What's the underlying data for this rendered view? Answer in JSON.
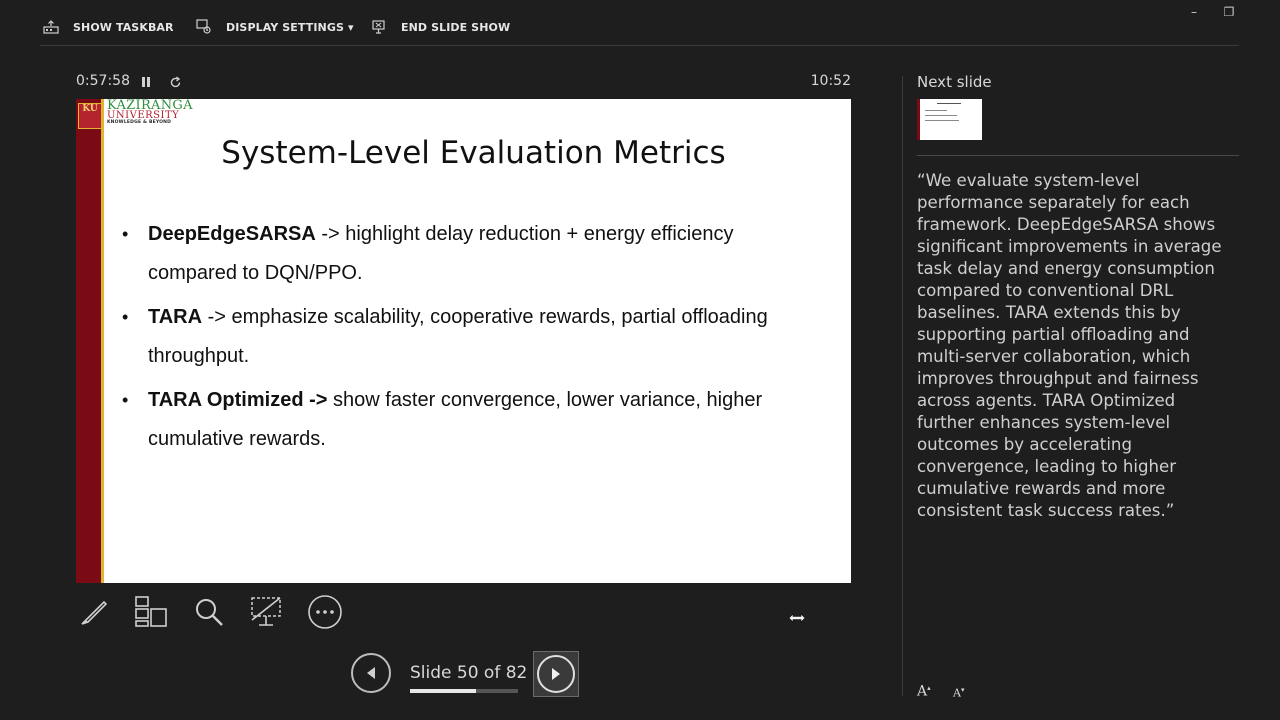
{
  "toolbar": {
    "show_taskbar": "SHOW TASKBAR",
    "display_settings": "DISPLAY SETTINGS ▾",
    "end_slide_show": "END SLIDE SHOW"
  },
  "window_controls": {
    "minimize": "–",
    "restore": "❐"
  },
  "timer": {
    "elapsed": "0:57:58",
    "clock": "10:52"
  },
  "slide": {
    "logo": {
      "seal": "KU",
      "name": "KAZIRANGA",
      "subname": "UNIVERSITY",
      "tagline": "KNOWLEDGE & BEYOND"
    },
    "title": "System-Level Evaluation Metrics",
    "bullets": [
      {
        "bold": "DeepEdgeSARSA",
        "text": " -> highlight delay reduction + energy efficiency compared to DQN/PPO."
      },
      {
        "bold": "TARA",
        "text": " -> emphasize scalability, cooperative rewards, partial offloading throughput."
      },
      {
        "bold": "TARA Optimized ->",
        "text": " show faster convergence, lower variance, higher cumulative rewards."
      }
    ]
  },
  "tools": [
    "pen-icon",
    "see-all-slides-icon",
    "zoom-icon",
    "black-screen-icon",
    "more-options-icon"
  ],
  "navigation": {
    "slide_label": "Slide 50 of 82",
    "progress": 0.61
  },
  "next_slide": {
    "label": "Next slide"
  },
  "notes": {
    "text": "“We evaluate system-level performance separately for each framework. DeepEdgeSARSA shows significant improvements in average task delay and energy consumption compared to conventional DRL baselines. TARA extends this by supporting partial offloading and multi-server collaboration, which improves throughput and fairness across agents. TARA Optimized further enhances system-level outcomes by accelerating convergence, leading to higher cumulative rewards and more consistent task success rates.”"
  },
  "font_controls": {
    "increase": "A",
    "decrease": "A"
  }
}
